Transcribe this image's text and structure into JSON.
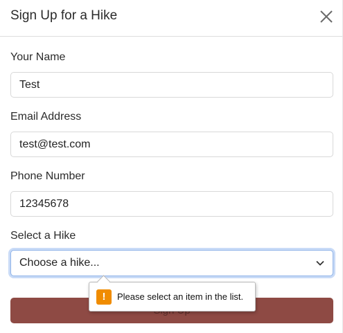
{
  "modal": {
    "title": "Sign Up for a Hike"
  },
  "form": {
    "name_label": "Your Name",
    "name_value": "Test",
    "email_label": "Email Address",
    "email_value": "test@test.com",
    "phone_label": "Phone Number",
    "phone_value": "12345678",
    "hike_label": "Select a Hike",
    "hike_selected": "Choose a hike...",
    "submit_label": "Sign Up"
  },
  "validation": {
    "message": "Please select an item in the list.",
    "icon": "warning-icon",
    "icon_glyph": "!"
  },
  "colors": {
    "submit_bg": "#8e4a44",
    "focus_ring": "#c9dbf7",
    "warning": "#f08c00"
  }
}
